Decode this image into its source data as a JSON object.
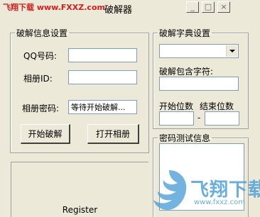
{
  "window": {
    "title": "破解器",
    "watermark_top": "飞翔下载 www.FXXZ.com"
  },
  "crack_info": {
    "legend": "破解信息设置",
    "qq_label": "QQ号码:",
    "qq_value": "",
    "album_id_label": "相册ID:",
    "album_id_value": "",
    "album_pwd_label": "相册密码:",
    "album_pwd_value": "等待开始破解...",
    "start_button": "开始破解",
    "open_album_button": "打开相册"
  },
  "dictionary": {
    "legend": "破解字典设置",
    "dict_select_value": "",
    "contains_label": "破解包含字符:",
    "contains_value": "",
    "start_digits_label": "开始位数",
    "end_digits_label": "结束位数",
    "start_digits_value": "",
    "end_digits_value": "",
    "dash": "-"
  },
  "test_info": {
    "legend": "密码测试信息"
  },
  "register": {
    "label": "Register"
  },
  "watermark": {
    "big": "飞翔下载",
    "small": "www.fxxz.com"
  }
}
